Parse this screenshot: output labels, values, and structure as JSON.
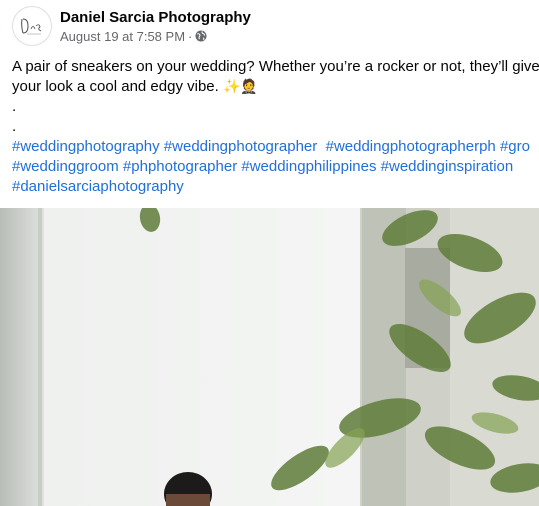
{
  "post": {
    "author": "Daniel Sarcia Photography",
    "date": "August 19 at 7:58 PM",
    "separator": "·",
    "privacy_icon": "globe-icon",
    "text_line1": "A pair of sneakers on your wedding? Whether you’re a rocker or not, they’ll give",
    "text_line2": "your look a cool and edgy vibe.",
    "emoji_sparkles": "✨",
    "emoji_groom": "🤵",
    "dot1": ".",
    "dot2": ".",
    "hashtags": [
      "#weddingphotography",
      "#weddingphotographer",
      "#weddingphotographerph",
      "#gro",
      "#weddinggroom",
      "#phphotographer",
      "#weddingphilippines",
      "#weddinginspiration",
      "#danielsarciaphotography"
    ]
  },
  "colors": {
    "link": "#216fdb",
    "text": "#050505",
    "meta": "#65676b"
  }
}
